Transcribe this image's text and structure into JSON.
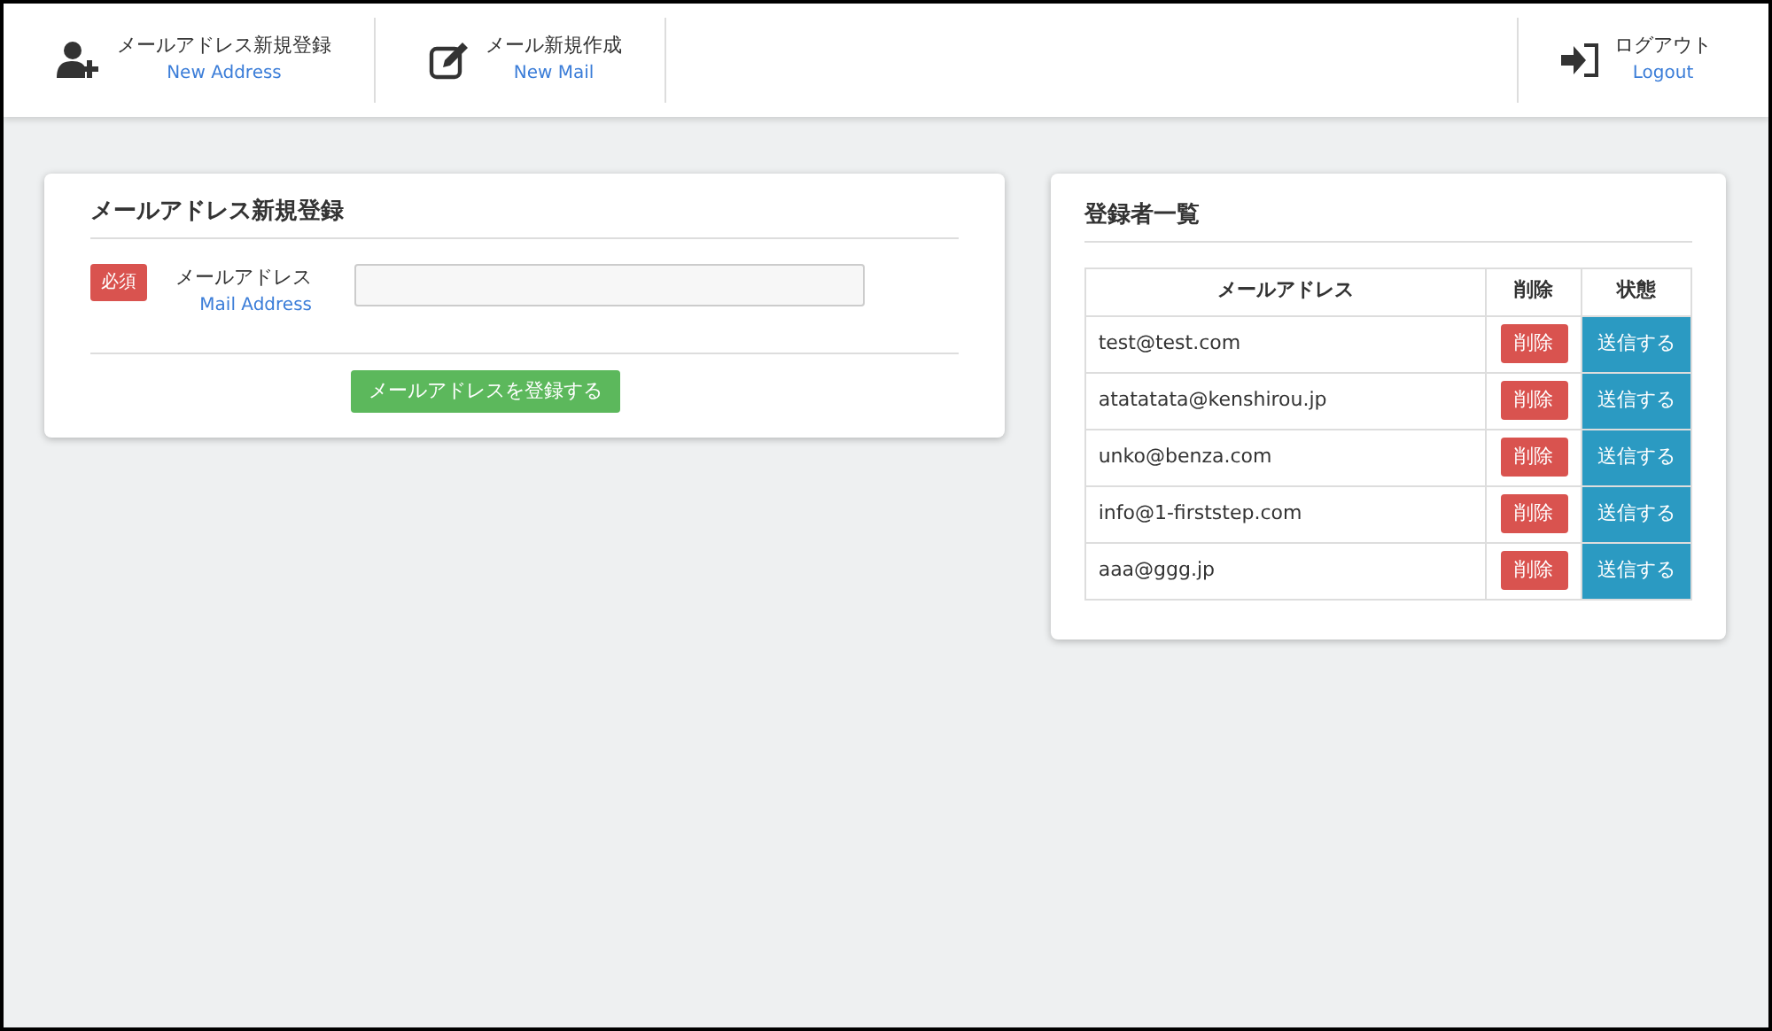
{
  "nav": {
    "items": [
      {
        "kind": "add-user",
        "label": "メールアドレス新規登録",
        "sublabel": "New Address"
      },
      {
        "kind": "compose",
        "label": "メール新規作成",
        "sublabel": "New Mail"
      }
    ],
    "logout": {
      "label": "ログアウト",
      "sublabel": "Logout"
    }
  },
  "register_form": {
    "title": "メールアドレス新規登録",
    "required_badge": "必須",
    "field_label": "メールアドレス",
    "field_sublabel": "Mail Address",
    "submit": "メールアドレスを登録する"
  },
  "registrants": {
    "title": "登録者一覧",
    "columns": [
      "メールアドレス",
      "削除",
      "状態"
    ],
    "rows": [
      {
        "email": "test@test.com",
        "delete": "削除",
        "status": "送信する"
      },
      {
        "email": "atatatata@kenshirou.jp",
        "delete": "削除",
        "status": "送信する"
      },
      {
        "email": "unko@benza.com",
        "delete": "削除",
        "status": "送信する"
      },
      {
        "email": "info@1-firststep.com",
        "delete": "削除",
        "status": "送信する"
      },
      {
        "email": "aaa@ggg.jp",
        "delete": "削除",
        "status": "送信する"
      }
    ]
  }
}
